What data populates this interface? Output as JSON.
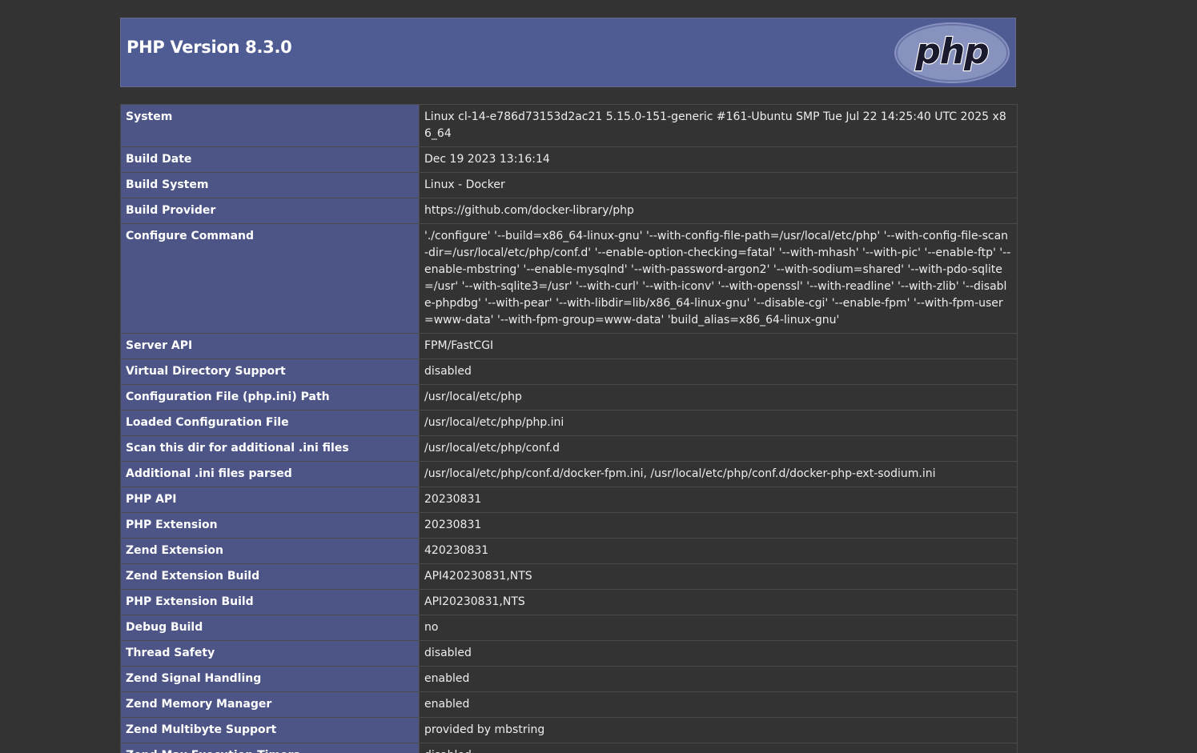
{
  "header": {
    "title": "PHP Version 8.3.0",
    "logo_text": "php",
    "logo_color": "#8892be"
  },
  "colors": {
    "background": "#333333",
    "header_bg": "#4f5b93",
    "key_bg": "#4c5586"
  },
  "rows": [
    {
      "key": "System",
      "value": "Linux cl-14-e786d73153d2ac21 5.15.0-151-generic #161-Ubuntu SMP Tue Jul 22 14:25:40 UTC 2025 x86_64"
    },
    {
      "key": "Build Date",
      "value": "Dec 19 2023 13:16:14"
    },
    {
      "key": "Build System",
      "value": "Linux - Docker"
    },
    {
      "key": "Build Provider",
      "value": "https://github.com/docker-library/php"
    },
    {
      "key": "Configure Command",
      "value": "'./configure' '--build=x86_64-linux-gnu' '--with-config-file-path=/usr/local/etc/php' '--with-config-file-scan-dir=/usr/local/etc/php/conf.d' '--enable-option-checking=fatal' '--with-mhash' '--with-pic' '--enable-ftp' '--enable-mbstring' '--enable-mysqlnd' '--with-password-argon2' '--with-sodium=shared' '--with-pdo-sqlite=/usr' '--with-sqlite3=/usr' '--with-curl' '--with-iconv' '--with-openssl' '--with-readline' '--with-zlib' '--disable-phpdbg' '--with-pear' '--with-libdir=lib/x86_64-linux-gnu' '--disable-cgi' '--enable-fpm' '--with-fpm-user=www-data' '--with-fpm-group=www-data' 'build_alias=x86_64-linux-gnu'"
    },
    {
      "key": "Server API",
      "value": "FPM/FastCGI"
    },
    {
      "key": "Virtual Directory Support",
      "value": "disabled"
    },
    {
      "key": "Configuration File (php.ini) Path",
      "value": "/usr/local/etc/php"
    },
    {
      "key": "Loaded Configuration File",
      "value": "/usr/local/etc/php/php.ini"
    },
    {
      "key": "Scan this dir for additional .ini files",
      "value": "/usr/local/etc/php/conf.d"
    },
    {
      "key": "Additional .ini files parsed",
      "value": "/usr/local/etc/php/conf.d/docker-fpm.ini, /usr/local/etc/php/conf.d/docker-php-ext-sodium.ini"
    },
    {
      "key": "PHP API",
      "value": "20230831"
    },
    {
      "key": "PHP Extension",
      "value": "20230831"
    },
    {
      "key": "Zend Extension",
      "value": "420230831"
    },
    {
      "key": "Zend Extension Build",
      "value": "API420230831,NTS"
    },
    {
      "key": "PHP Extension Build",
      "value": "API20230831,NTS"
    },
    {
      "key": "Debug Build",
      "value": "no"
    },
    {
      "key": "Thread Safety",
      "value": "disabled"
    },
    {
      "key": "Zend Signal Handling",
      "value": "enabled"
    },
    {
      "key": "Zend Memory Manager",
      "value": "enabled"
    },
    {
      "key": "Zend Multibyte Support",
      "value": "provided by mbstring"
    },
    {
      "key": "Zend Max Execution Timers",
      "value": "disabled"
    },
    {
      "key": "",
      "value": ""
    }
  ]
}
